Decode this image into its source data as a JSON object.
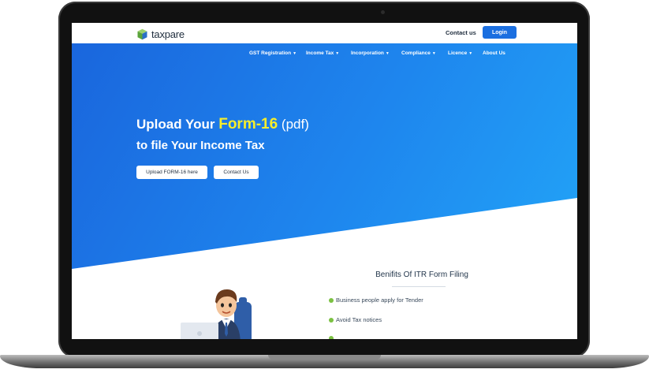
{
  "header": {
    "logo_text": "taxpare",
    "contact_label": "Contact us",
    "login_label": "Login"
  },
  "nav": {
    "items": [
      {
        "label": "GST Registration",
        "dropdown": true
      },
      {
        "label": "Income Tax",
        "dropdown": true
      },
      {
        "label": "Incorporation",
        "dropdown": true
      },
      {
        "label": "Compliance",
        "dropdown": true
      },
      {
        "label": "Licence",
        "dropdown": true
      },
      {
        "label": "About Us",
        "dropdown": false
      }
    ]
  },
  "hero": {
    "line1_prefix": "Upload Your ",
    "line1_highlight": "Form-16",
    "line1_suffix": " (pdf)",
    "line2": "to file Your Income Tax",
    "upload_button": "Upload FORM-16 here",
    "contact_button": "Contact Us"
  },
  "benefits": {
    "title": "Benifits Of ITR Form Filing",
    "items": [
      "Business people apply for Tender",
      "Avoid Tax notices"
    ]
  },
  "colors": {
    "brand_blue": "#1b6fe0",
    "hero_gradient_start": "#1a66dd",
    "hero_gradient_end": "#22a4f7",
    "highlight_yellow": "#f7ee2b",
    "bullet_green": "#7bc142"
  }
}
